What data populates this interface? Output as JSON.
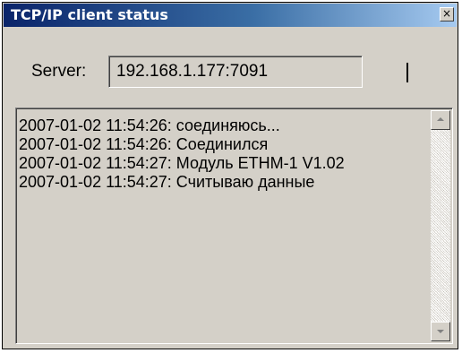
{
  "window": {
    "title": "TCP/IP client status",
    "close_glyph": "×",
    "close_icon": "close-icon"
  },
  "server": {
    "label": "Server:",
    "value": "192.168.1.177:7091"
  },
  "log": {
    "lines": [
      "2007-01-02 11:54:26: соединяюсь...",
      "2007-01-02 11:54:26: Соединился",
      "2007-01-02 11:54:27: Модуль ETHM-1 V1.02",
      "2007-01-02 11:54:27: Считываю данные"
    ]
  },
  "colors": {
    "titlebar_start": "#0a246a",
    "titlebar_end": "#a6caf0",
    "face": "#d4d0c8"
  }
}
